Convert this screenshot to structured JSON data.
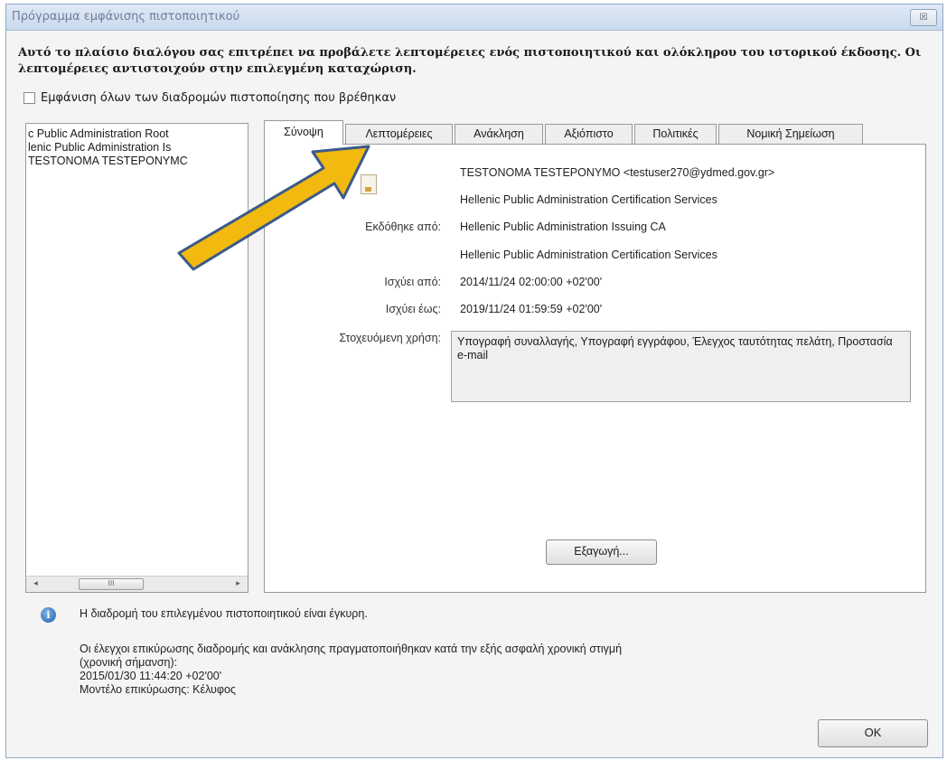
{
  "window": {
    "title": "Πρόγραμμα εμφάνισης πιστοποιητικού",
    "close_label": "☒"
  },
  "intro_text": "Αυτό το πλαίσιο διαλόγου σας επιτρέπει να προβάλετε λεπτομέρειες ενός πιστοποιητικού και ολόκληρου του ιστορικού έκδοσης. Οι λεπτομέρειες αντιστοιχούν στην επιλεγμένη καταχώριση.",
  "show_all_paths": {
    "label": "Εμφάνιση όλων των διαδρομών πιστοποίησης που βρέθηκαν",
    "checked": false
  },
  "tree": {
    "items": [
      "c Public Administration Root",
      "lenic Public Administration Is",
      "TESTONOMA TESTEPONYMC"
    ],
    "scroll_left": "◂",
    "scroll_thumb": "III",
    "scroll_right": "▸"
  },
  "tabs": [
    {
      "label": "Σύνοψη",
      "active": true
    },
    {
      "label": "Λεπτομέρειες",
      "active": false
    },
    {
      "label": "Ανάκληση",
      "active": false
    },
    {
      "label": "Αξιόπιστο",
      "active": false
    },
    {
      "label": "Πολιτικές",
      "active": false
    },
    {
      "label": "Νομική Σημείωση",
      "active": false
    }
  ],
  "summary": {
    "subject_name": "TESTONOMA TESTEPONYMO <testuser270@ydmed.gov.gr>",
    "subject_org": "Hellenic Public Administration Certification Services",
    "issued_by_label": "Εκδόθηκε από:",
    "issuer_name": "Hellenic Public Administration Issuing CA",
    "issuer_org": "Hellenic Public Administration Certification Services",
    "valid_from_label": "Ισχύει από:",
    "valid_from": "2014/11/24 02:00:00 +02'00'",
    "valid_to_label": "Ισχύει έως:",
    "valid_to": "2019/11/24 01:59:59 +02'00'",
    "intended_use_label": "Στοχευόμενη χρήση:",
    "intended_use": "Υπογραφή συναλλαγής, Υπογραφή εγγράφου, Έλεγχος ταυτότητας πελάτη, Προστασία e-mail",
    "export_label": "Εξαγωγή..."
  },
  "status": {
    "valid_path": "Η διαδρομή του επιλεγμένου πιστοποιητικού είναι έγκυρη.",
    "line1": "Οι έλεγχοι επικύρωσης διαδρομής και ανάκλησης πραγματοποιήθηκαν κατά την εξής ασφαλή χρονική στιγμή",
    "line2": "(χρονική σήμανση):",
    "timestamp": "2015/01/30 11:44:20 +02'00'",
    "model": "Μοντέλο επικύρωσης: Κέλυφος"
  },
  "ok_label": "OK",
  "colors": {
    "arrow_fill": "#f2b90f",
    "arrow_stroke": "#3b5a8a"
  }
}
